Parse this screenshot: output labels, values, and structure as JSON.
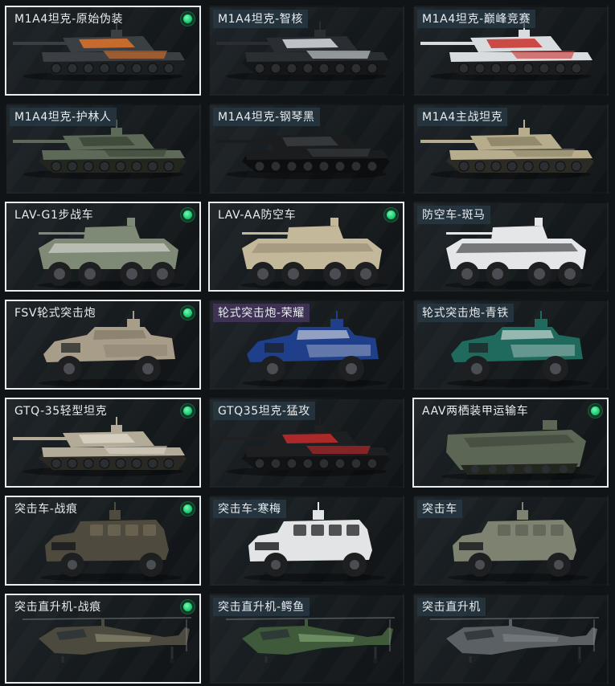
{
  "vehicles": [
    {
      "name": "M1A4坦克-原始伪装",
      "selected": true,
      "equipped": true,
      "icon": "tank-icon",
      "colors": {
        "body": "#3a3f44",
        "accent": "#e0722a",
        "track": "#1c1f22"
      }
    },
    {
      "name": "M1A4坦克-智核",
      "selected": false,
      "equipped": false,
      "icon": "tank-icon",
      "colors": {
        "body": "#2a2d31",
        "accent": "#d8dde0",
        "track": "#141618"
      }
    },
    {
      "name": "M1A4坦克-巅峰竞赛",
      "selected": false,
      "equipped": false,
      "icon": "tank-icon",
      "colors": {
        "body": "#d9dcdf",
        "accent": "#c8302c",
        "track": "#1b1d1f"
      }
    },
    {
      "name": "M1A4坦克-护林人",
      "selected": false,
      "equipped": false,
      "icon": "tank-icon",
      "colors": {
        "body": "#5d6a58",
        "accent": "#3b4536",
        "track": "#22261f"
      }
    },
    {
      "name": "M1A4坦克-钢琴黑",
      "selected": false,
      "equipped": false,
      "icon": "tank-icon",
      "colors": {
        "body": "#1a1c1e",
        "accent": "#3a3d40",
        "track": "#0d0e0f"
      }
    },
    {
      "name": "M1A4主战坦克",
      "selected": false,
      "equipped": false,
      "icon": "tank-icon",
      "colors": {
        "body": "#b7ac8c",
        "accent": "#8d8468",
        "track": "#2b2a25"
      }
    },
    {
      "name": "LAV-G1步战车",
      "selected": true,
      "equipped": true,
      "icon": "apc-icon",
      "colors": {
        "body": "#7f8a76",
        "accent": "#e6e8e4",
        "track": "#1e2120"
      }
    },
    {
      "name": "LAV-AA防空车",
      "selected": true,
      "equipped": true,
      "icon": "apc-icon",
      "colors": {
        "body": "#c4b89a",
        "accent": "#8f8470",
        "track": "#1e2120"
      }
    },
    {
      "name": "防空车-斑马",
      "selected": false,
      "equipped": false,
      "icon": "apc-icon",
      "colors": {
        "body": "#e4e6e8",
        "accent": "#1b1c1d",
        "track": "#1e2120"
      }
    },
    {
      "name": "FSV轮式突击炮",
      "selected": true,
      "equipped": true,
      "icon": "wheeled-vehicle-icon",
      "colors": {
        "body": "#a89d88",
        "accent": "#7b7263",
        "track": "#1e2120"
      }
    },
    {
      "name": "轮式突击炮-荣耀",
      "selected": false,
      "equipped": false,
      "icon": "wheeled-vehicle-icon",
      "labelTint": "purple",
      "colors": {
        "body": "#1f3f8a",
        "accent": "#dfe3e8",
        "track": "#1e2120"
      }
    },
    {
      "name": "轮式突击炮-青铁",
      "selected": false,
      "equipped": false,
      "icon": "wheeled-vehicle-icon",
      "colors": {
        "body": "#1f6a5c",
        "accent": "#e7ecea",
        "track": "#1e2120"
      }
    },
    {
      "name": "GTQ-35轻型坦克",
      "selected": true,
      "equipped": true,
      "icon": "light-tank-icon",
      "colors": {
        "body": "#b3ab97",
        "accent": "#d9d4c6",
        "track": "#2a2824"
      }
    },
    {
      "name": "GTQ35坦克-猛攻",
      "selected": false,
      "equipped": false,
      "icon": "light-tank-icon",
      "colors": {
        "body": "#1e1f21",
        "accent": "#c62a2a",
        "track": "#121314"
      }
    },
    {
      "name": "AAV两栖装甲运输车",
      "selected": true,
      "equipped": true,
      "icon": "amphibious-icon",
      "colors": {
        "body": "#5c6654",
        "accent": "#3f473a",
        "track": "#22261f"
      }
    },
    {
      "name": "突击车-战痕",
      "selected": true,
      "equipped": true,
      "icon": "assault-vehicle-icon",
      "colors": {
        "body": "#4f4a3e",
        "accent": "#6e6754",
        "track": "#1e2120"
      }
    },
    {
      "name": "突击车-寒梅",
      "selected": false,
      "equipped": false,
      "icon": "assault-vehicle-icon",
      "colors": {
        "body": "#e2e4e6",
        "accent": "#2a2c2e",
        "track": "#1e2120"
      }
    },
    {
      "name": "突击车",
      "selected": false,
      "equipped": false,
      "icon": "assault-vehicle-icon",
      "colors": {
        "body": "#7d8271",
        "accent": "#5e6356",
        "track": "#1e2120"
      }
    },
    {
      "name": "突击直升机-战痕",
      "selected": true,
      "equipped": true,
      "icon": "helicopter-icon",
      "colors": {
        "body": "#4c4a3e",
        "accent": "#8a8670",
        "track": "#1e2120"
      }
    },
    {
      "name": "突击直升机-鳄鱼",
      "selected": false,
      "equipped": false,
      "icon": "helicopter-icon",
      "colors": {
        "body": "#3f5a3a",
        "accent": "#7fa072",
        "track": "#1e2120"
      }
    },
    {
      "name": "突击直升机",
      "selected": false,
      "equipped": false,
      "icon": "helicopter-icon",
      "colors": {
        "body": "#5b6064",
        "accent": "#7a8085",
        "track": "#1e2120"
      }
    }
  ],
  "colors": {
    "selected_border": "#e9edef",
    "equipped_dot": "#22d07a",
    "background": "#111417"
  }
}
